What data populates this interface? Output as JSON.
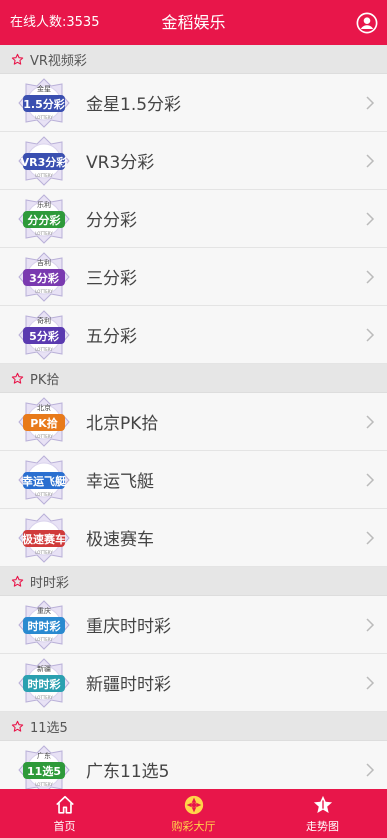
{
  "header": {
    "online_label": "在线人数:3535",
    "title": "金稻娱乐",
    "user_icon": "user-circle-icon"
  },
  "sections": [
    {
      "title": "VR视频彩",
      "items": [
        {
          "name": "金星1.5分彩",
          "badge_top": "金星",
          "badge_main": "1.5分彩",
          "color": "#3a4fb0"
        },
        {
          "name": "VR3分彩",
          "badge_top": "",
          "badge_main": "VR3分彩",
          "color": "#3a4fb0"
        },
        {
          "name": "分分彩",
          "badge_top": "乐利",
          "badge_main": "分分彩",
          "color": "#2e9a3a"
        },
        {
          "name": "三分彩",
          "badge_top": "吉利",
          "badge_main": "3分彩",
          "color": "#7a3ab0"
        },
        {
          "name": "五分彩",
          "badge_top": "奇利",
          "badge_main": "5分彩",
          "color": "#5a3ab0"
        }
      ]
    },
    {
      "title": "PK拾",
      "items": [
        {
          "name": "北京PK拾",
          "badge_top": "北京",
          "badge_main": "PK拾",
          "color": "#e87a1a"
        },
        {
          "name": "幸运飞艇",
          "badge_top": "",
          "badge_main": "幸运飞艇",
          "color": "#2a6fd0"
        },
        {
          "name": "极速赛车",
          "badge_top": "",
          "badge_main": "极速赛车",
          "color": "#d03a3a"
        }
      ]
    },
    {
      "title": "时时彩",
      "items": [
        {
          "name": "重庆时时彩",
          "badge_top": "重庆",
          "badge_main": "时时彩",
          "color": "#2a8ad0"
        },
        {
          "name": "新疆时时彩",
          "badge_top": "新疆",
          "badge_main": "时时彩",
          "color": "#2aa0b0"
        }
      ]
    },
    {
      "title": "11选5",
      "items": [
        {
          "name": "广东11选5",
          "badge_top": "广东",
          "badge_main": "11选5",
          "color": "#2e9a3a"
        }
      ]
    }
  ],
  "tabbar": {
    "items": [
      {
        "label": "首页",
        "icon": "home-icon"
      },
      {
        "label": "购彩大厅",
        "icon": "aperture-icon"
      },
      {
        "label": "走势图",
        "icon": "star-chart-icon"
      }
    ],
    "active_index": 1,
    "active_color": "#ffd54a"
  },
  "colors": {
    "brand": "#e8164a",
    "section_bg": "#e6e6e6",
    "row_bg": "#f7f7f7"
  }
}
